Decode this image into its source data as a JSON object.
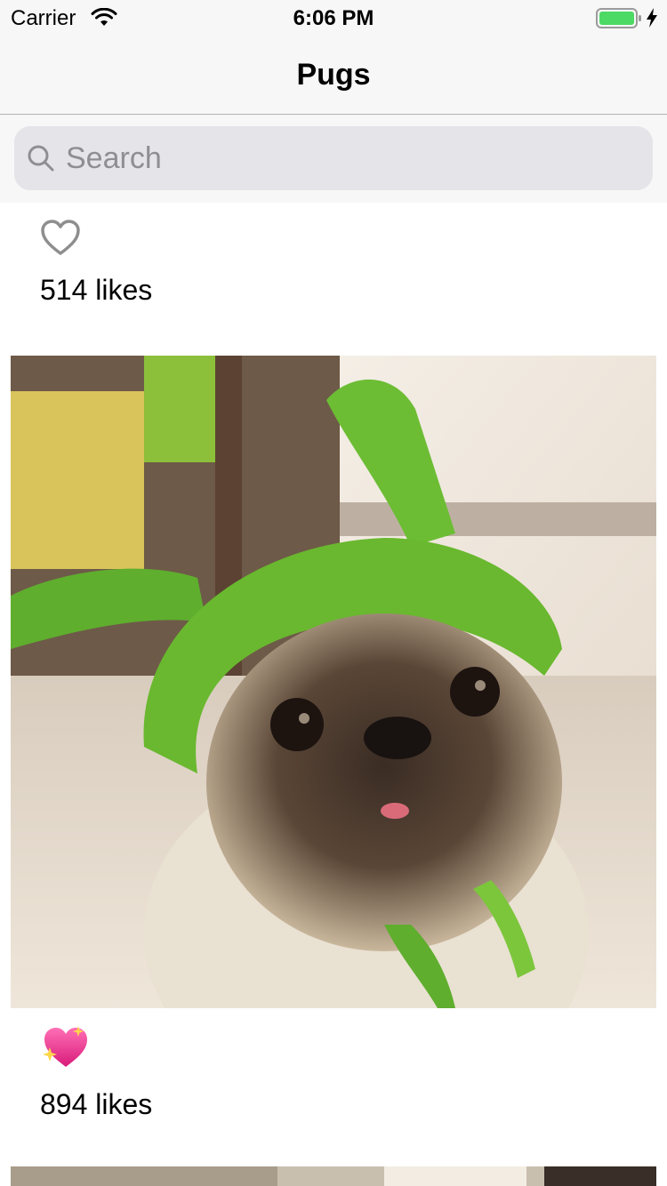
{
  "status_bar": {
    "carrier": "Carrier",
    "time": "6:06 PM",
    "battery_level": 1.0,
    "icons": [
      "wifi-icon",
      "battery-icon",
      "charging-bolt-icon"
    ]
  },
  "nav": {
    "title": "Pugs"
  },
  "search": {
    "placeholder": "Search",
    "value": ""
  },
  "posts": [
    {
      "likes_text": "514 likes",
      "liked": false,
      "like_icon": "heart-outline-icon"
    },
    {
      "photo": "pug-in-green-crochet-hat",
      "likes_text": "894 likes",
      "liked": true,
      "like_icon": "sparkling-heart-icon"
    },
    {
      "photo": "pug-photo-partial"
    }
  ],
  "colors": {
    "bar_background": "#f7f7f7",
    "search_field": "#e4e4e9",
    "placeholder": "#8e8e93",
    "liked_heart": "#e83e8c",
    "battery": "#4cd964"
  }
}
